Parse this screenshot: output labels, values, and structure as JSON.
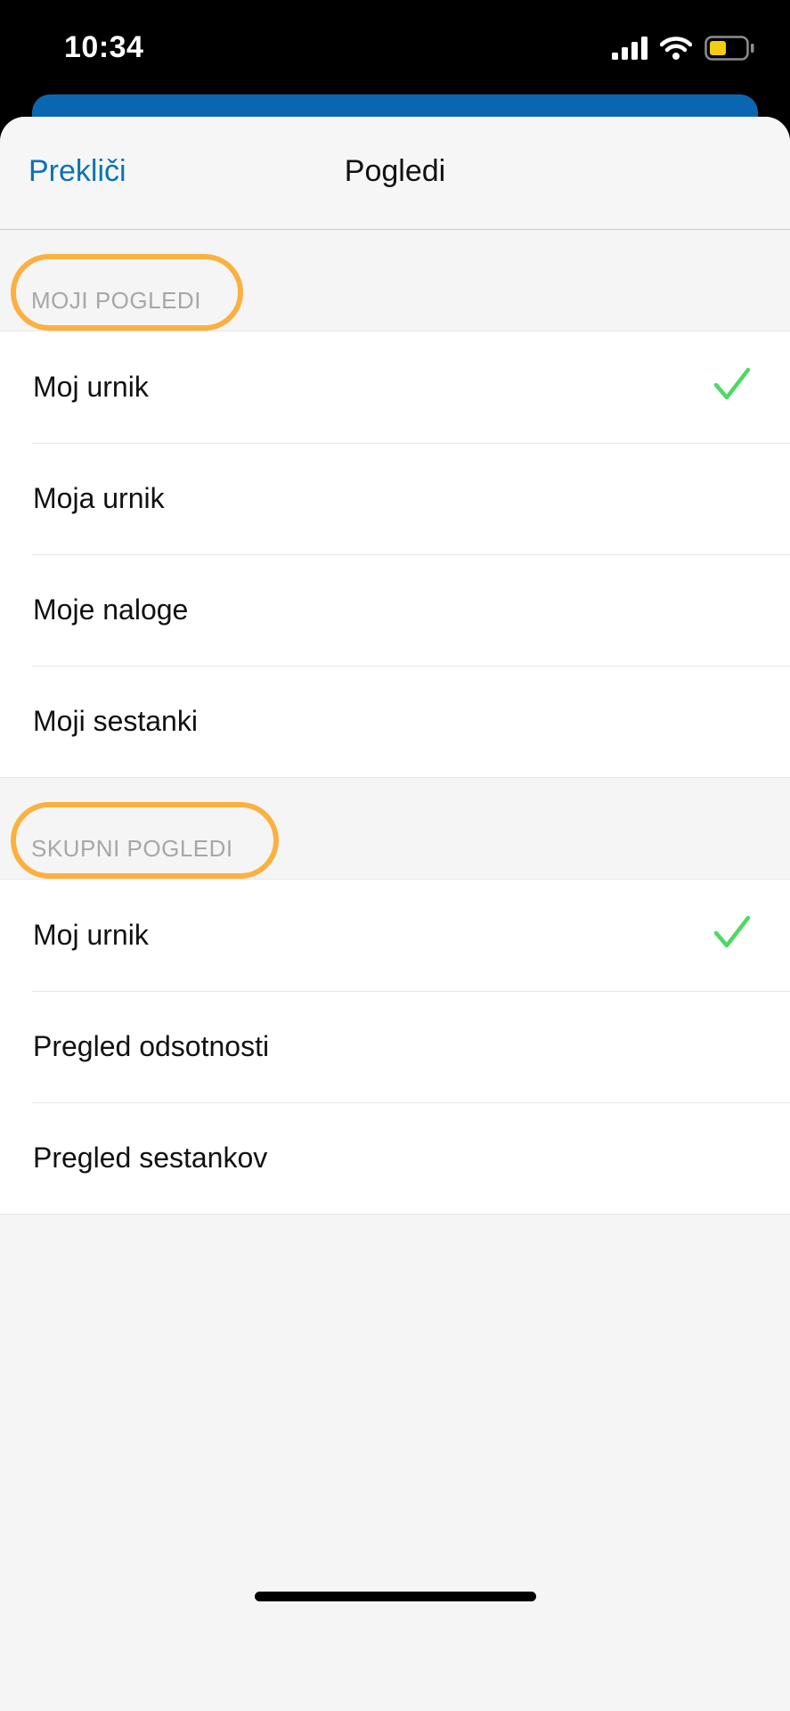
{
  "status_bar": {
    "time": "10:34",
    "icons": [
      "cellular-signal-icon",
      "wifi-icon",
      "battery-icon"
    ],
    "battery_color": "#f5cc14"
  },
  "header": {
    "cancel_label": "Prekliči",
    "title": "Pogledi"
  },
  "sections": [
    {
      "label": "MOJI POGLEDI",
      "items": [
        {
          "label": "Moj urnik",
          "selected": true
        },
        {
          "label": "Moja urnik",
          "selected": false
        },
        {
          "label": "Moje naloge",
          "selected": false
        },
        {
          "label": "Moji sestanki",
          "selected": false
        }
      ]
    },
    {
      "label": "SKUPNI POGLEDI",
      "items": [
        {
          "label": "Moj urnik",
          "selected": true
        },
        {
          "label": "Pregled odsotnosti",
          "selected": false
        },
        {
          "label": "Pregled sestankov",
          "selected": false
        }
      ]
    }
  ],
  "colors": {
    "accent": "#0b73b5",
    "check": "#4cd964",
    "highlight": "#fbb040"
  }
}
